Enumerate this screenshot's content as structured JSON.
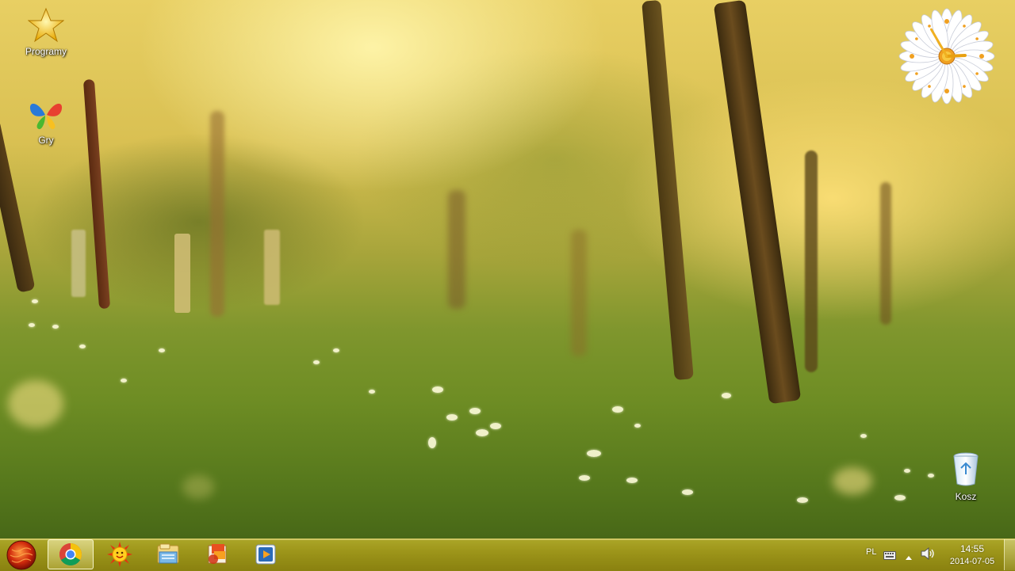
{
  "desktop": {
    "icons": [
      {
        "label": "Programy",
        "icon": "star-icon"
      },
      {
        "label": "Gry",
        "icon": "games-butterfly-icon"
      },
      {
        "label": "Kosz",
        "icon": "recycle-bin-icon"
      }
    ]
  },
  "gadget": {
    "name": "daisy-clock-gadget",
    "hour": 14,
    "minute": 55
  },
  "taskbar": {
    "start": {
      "icon": "start-orb-icon"
    },
    "pinned": [
      {
        "icon": "chrome-icon",
        "active": true
      },
      {
        "icon": "sun-smiley-icon",
        "active": false
      },
      {
        "icon": "file-explorer-icon",
        "active": false
      },
      {
        "icon": "office-icon",
        "active": false
      },
      {
        "icon": "media-player-icon",
        "active": false
      }
    ],
    "tray": {
      "language": "PL",
      "time": "14:55",
      "date": "2014-07-05",
      "icons": [
        "keyboard-icon",
        "show-hidden-icons-arrow",
        "volume-icon"
      ]
    }
  },
  "colors": {
    "taskbar": "#a89a1e",
    "wallpaper_sky": "#e8cf63",
    "wallpaper_grass": "#56781c"
  }
}
